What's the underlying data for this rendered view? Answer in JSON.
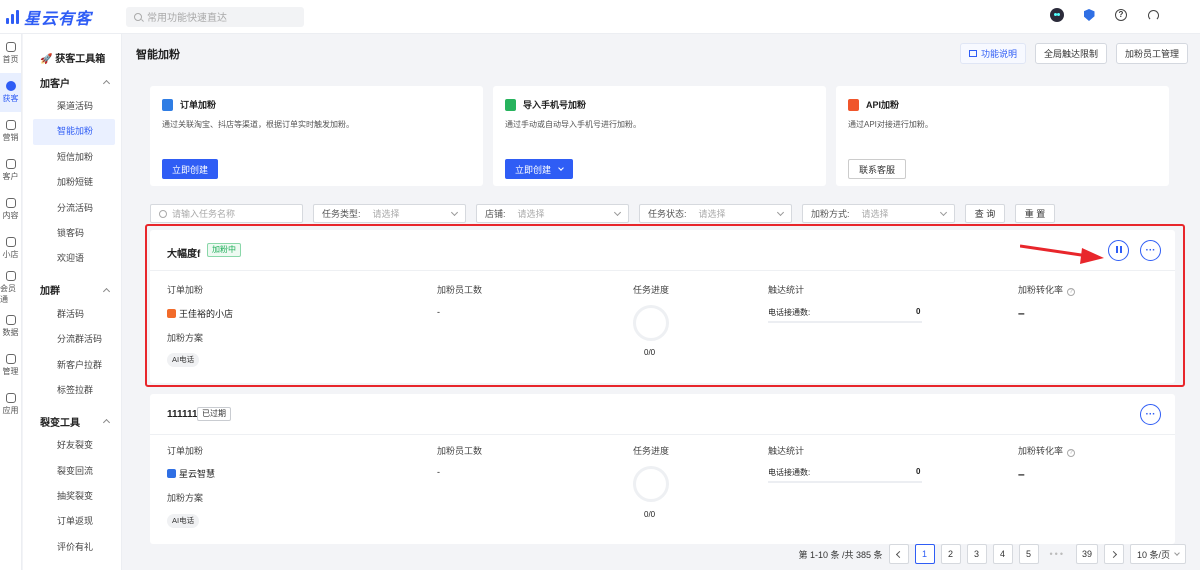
{
  "app": {
    "name": "星云有客",
    "search_placeholder": "常用功能快速直达"
  },
  "rail": [
    {
      "label": "首页",
      "icon": "home-icon"
    },
    {
      "label": "获客",
      "icon": "user-icon",
      "active": true
    },
    {
      "label": "营销",
      "icon": "marketing-icon"
    },
    {
      "label": "客户",
      "icon": "customer-icon"
    },
    {
      "label": "内容",
      "icon": "folder-icon"
    },
    {
      "label": "小店",
      "icon": "shop-icon"
    },
    {
      "label": "会员通",
      "icon": "member-icon"
    },
    {
      "label": "数据",
      "icon": "chart-icon"
    },
    {
      "label": "管理",
      "icon": "grid-icon"
    },
    {
      "label": "应用",
      "icon": "app-icon"
    }
  ],
  "subnav": {
    "title": "🚀 获客工具箱",
    "groups": [
      {
        "name": "加客户",
        "items": [
          "渠道活码",
          "智能加粉",
          "短信加粉",
          "加粉短链",
          "分流活码",
          "锁客码",
          "欢迎语"
        ]
      },
      {
        "name": "加群",
        "items": [
          "群活码",
          "分流群活码",
          "新客户拉群",
          "标签拉群"
        ]
      },
      {
        "name": "裂变工具",
        "items": [
          "好友裂变",
          "裂变回流",
          "抽奖裂变",
          "订单返现",
          "评价有礼"
        ]
      }
    ],
    "active": "智能加粉"
  },
  "page": {
    "title": "智能加粉",
    "btn_help": "功能说明",
    "btn_limit": "全局触达限制",
    "btn_staff": "加粉员工管理"
  },
  "cards": [
    {
      "title": "订单加粉",
      "desc": "通过关联淘宝、抖店等渠道，根据订单实时触发加粉。",
      "btn": "立即创建",
      "color": "#2f7de4"
    },
    {
      "title": "导入手机号加粉",
      "desc": "通过手动或自动导入手机号进行加粉。",
      "btn": "立即创建",
      "color": "#27b35d"
    },
    {
      "title": "API加粉",
      "desc": "通过API对接进行加粉。",
      "btn": "联系客服",
      "color": "#f0552b"
    }
  ],
  "filters": {
    "search_placeholder": "请输入任务名称",
    "type_label": "任务类型:",
    "type_ph": "请选择",
    "shop_label": "店铺:",
    "shop_ph": "请选择",
    "status_label": "任务状态:",
    "status_ph": "请选择",
    "method_label": "加粉方式:",
    "method_ph": "请选择",
    "query": "查 询",
    "reset": "重 置"
  },
  "columns": {
    "source": "订单加粉",
    "plan": "加粉方案",
    "staff": "加粉员工数",
    "progress": "任务进度",
    "reach": "触达统计",
    "rate": "加粉转化率",
    "reach_item": "电话接通数:"
  },
  "tasks": [
    {
      "name": "大幅度f",
      "status": "加粉中",
      "shop": "王佳裕的小店",
      "staff": "-",
      "progress": "0/0",
      "reach_value": "0",
      "rate": "–",
      "plan": "AI电话"
    },
    {
      "name": "111111",
      "status": "已过期",
      "shop": "星云智慧",
      "staff": "-",
      "progress": "0/0",
      "reach_value": "0",
      "rate": "–",
      "plan": "AI电话"
    }
  ],
  "pager": {
    "summary": "第 1-10 条 /共 385 条",
    "pages": [
      "1",
      "2",
      "3",
      "4",
      "5"
    ],
    "dots": "•••",
    "last": "39",
    "size": "10 条/页"
  }
}
